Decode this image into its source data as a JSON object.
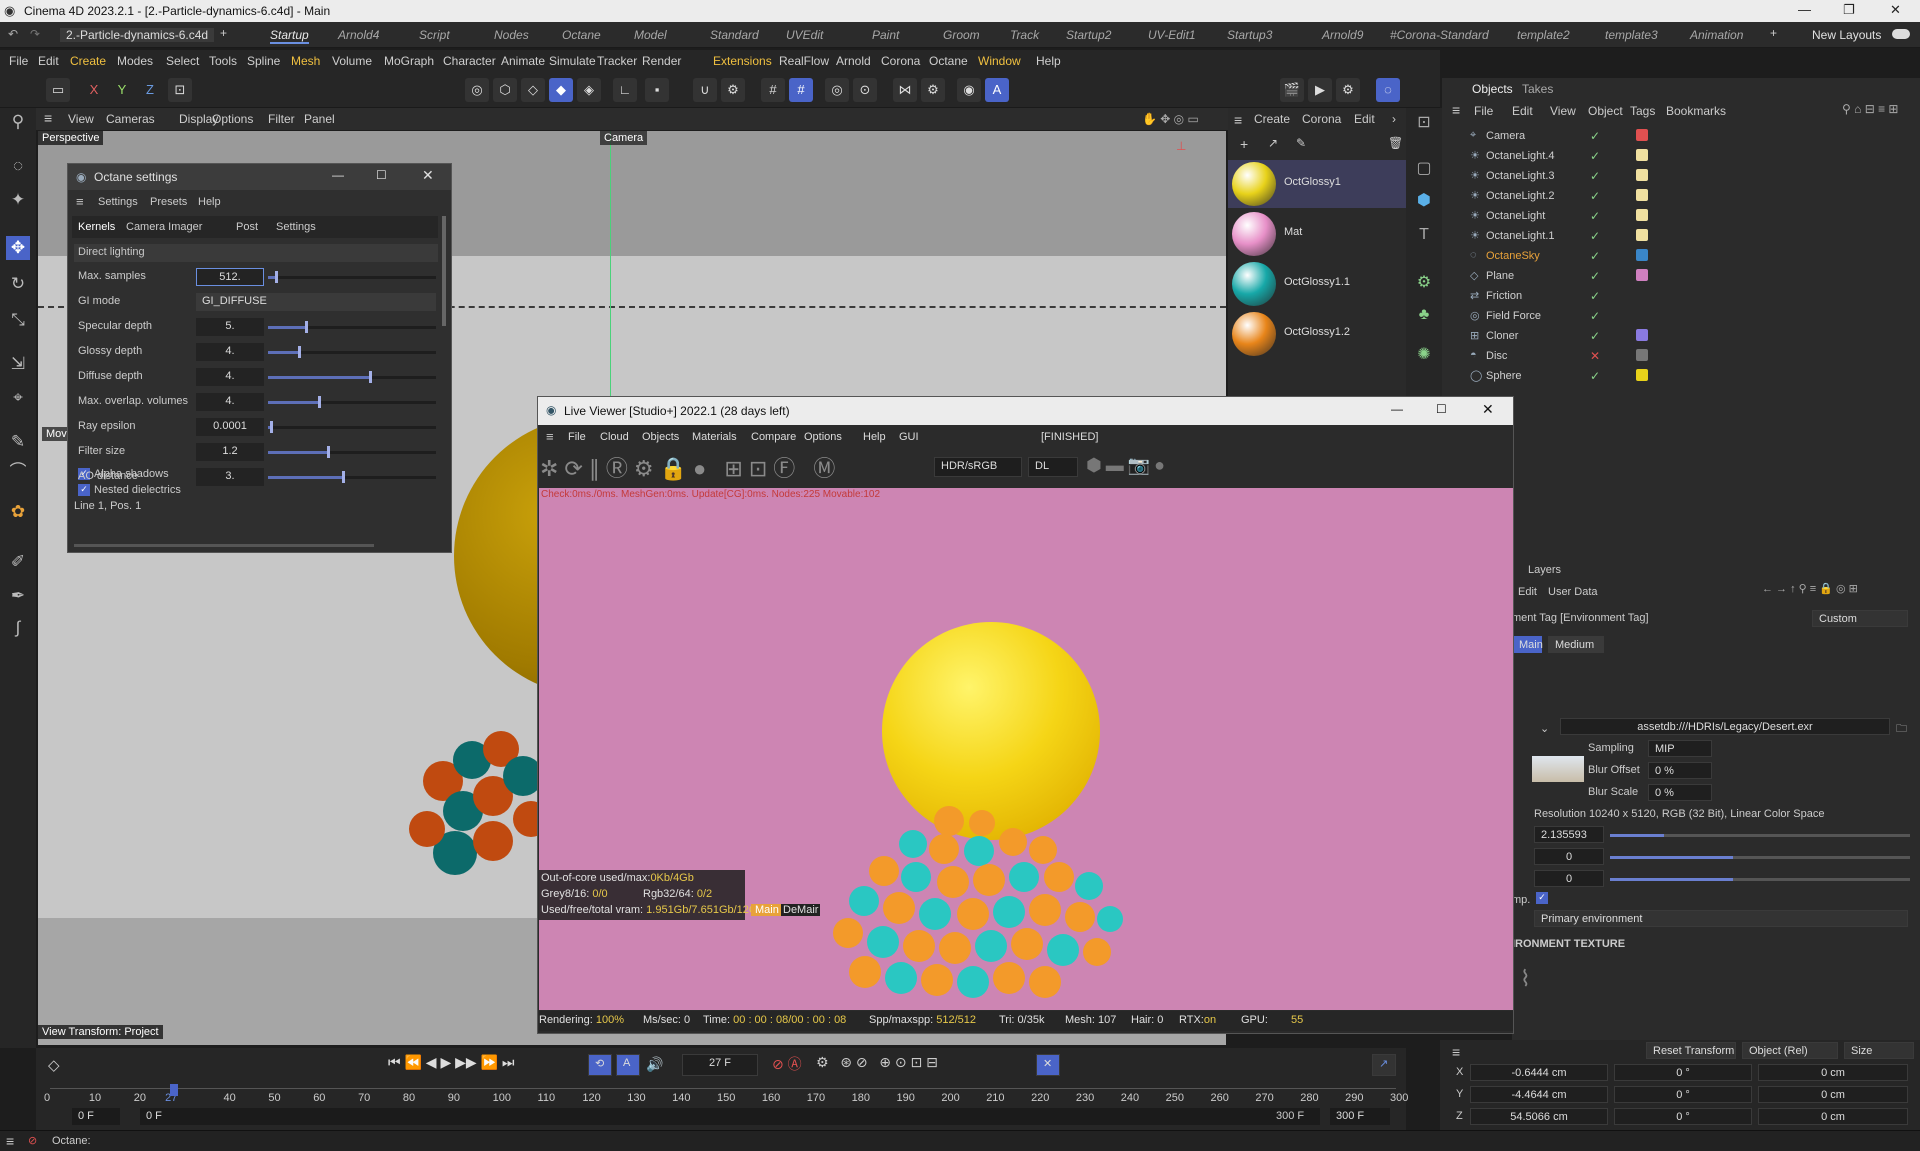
{
  "window": {
    "title": "Cinema 4D 2023.2.1 - [2.-Particle-dynamics-6.c4d] - Main"
  },
  "doc_tab": "2.-Particle-dynamics-6.c4d",
  "layout_tabs": [
    "Startup",
    "Arnold4",
    "Script",
    "Nodes",
    "Octane",
    "Model",
    "Standard",
    "UVEdit",
    "Paint",
    "Groom",
    "Track",
    "Startup2",
    "UV-Edit1",
    "Startup3",
    "Arnold9",
    "#Corona-Standard",
    "template2",
    "template3",
    "Animation"
  ],
  "active_layout": "Startup",
  "new_layouts": "New Layouts",
  "menu": [
    "File",
    "Edit",
    "Create",
    "Modes",
    "Select",
    "Tools",
    "Spline",
    "Mesh",
    "Volume",
    "MoGraph",
    "Character",
    "Animate",
    "Simulate",
    "Tracker",
    "Render",
    "Extensions",
    "RealFlow",
    "Arnold",
    "Corona",
    "Octane",
    "Window",
    "Help"
  ],
  "viewport": {
    "menu": [
      "View",
      "Cameras",
      "Display",
      "Options",
      "Filter",
      "Panel"
    ],
    "label": "Perspective",
    "camera_label": "Camera",
    "move_label": "Mov",
    "transform_label": "View Transform: Project"
  },
  "materials": {
    "menu": [
      "Create",
      "Corona",
      "Edit"
    ],
    "items": [
      {
        "name": "OctGlossy1",
        "color": "#e8d21a"
      },
      {
        "name": "Mat",
        "color": "#e790c8"
      },
      {
        "name": "OctGlossy1.1",
        "color": "#17a8a8"
      },
      {
        "name": "OctGlossy1.2",
        "color": "#e8851a"
      }
    ]
  },
  "objects_panel": {
    "tabs": [
      "Objects",
      "Takes"
    ],
    "menu": [
      "File",
      "Edit",
      "View",
      "Object",
      "Tags",
      "Bookmarks"
    ],
    "items": [
      {
        "name": "Camera",
        "color": "#d0d0d0"
      },
      {
        "name": "OctaneLight.4",
        "color": "#d0d0d0"
      },
      {
        "name": "OctaneLight.3",
        "color": "#d0d0d0"
      },
      {
        "name": "OctaneLight.2",
        "color": "#d0d0d0"
      },
      {
        "name": "OctaneLight",
        "color": "#d0d0d0"
      },
      {
        "name": "OctaneLight.1",
        "color": "#d0d0d0"
      },
      {
        "name": "OctaneSky",
        "color": "#e8a23a"
      },
      {
        "name": "Plane",
        "color": "#d0d0d0"
      },
      {
        "name": "Friction",
        "color": "#d0d0d0"
      },
      {
        "name": "Field Force",
        "color": "#d0d0d0"
      },
      {
        "name": "Cloner",
        "color": "#d0d0d0"
      },
      {
        "name": "Disc",
        "color": "#d0d0d0"
      },
      {
        "name": "Sphere",
        "color": "#d0d0d0"
      }
    ]
  },
  "attributes": {
    "layers_tab": "Layers",
    "menu": [
      "Edit",
      "User Data"
    ],
    "tag_title": "ment Tag [Environment Tag]",
    "mode": "Custom",
    "tabs": [
      "Main",
      "Medium"
    ],
    "texture_path": "assetdb:///HDRIs/Legacy/Desert.exr",
    "sampling_label": "Sampling",
    "sampling_value": "MIP",
    "blur_offset_label": "Blur Offset",
    "blur_offset_value": "0 %",
    "blur_scale_label": "Blur Scale",
    "blur_scale_value": "0 %",
    "resolution": "Resolution 10240 x 5120, RGB (32 Bit), Linear Color Space",
    "power": "2.135593",
    "rot_x": "0",
    "rot_y": "0",
    "imp_label": "mp.",
    "env_type": "Primary environment",
    "section": "IRONMENT TEXTURE"
  },
  "coords": {
    "reset": "Reset Transform",
    "mode": "Object (Rel)",
    "size": "Size",
    "rows": [
      {
        "axis": "X",
        "pos": "-0.6444 cm",
        "rot": "0 °",
        "size": "0 cm"
      },
      {
        "axis": "Y",
        "pos": "-4.4644 cm",
        "rot": "0 °",
        "size": "0 cm"
      },
      {
        "axis": "Z",
        "pos": "54.5066 cm",
        "rot": "0 °",
        "size": "0 cm"
      }
    ]
  },
  "timeline": {
    "frame": "27 F",
    "ticks": [
      "0",
      "10",
      "20",
      "27",
      "40",
      "50",
      "60",
      "70",
      "80",
      "90",
      "100",
      "110",
      "120",
      "130",
      "140",
      "150",
      "160",
      "170",
      "180",
      "190",
      "200",
      "210",
      "220",
      "230",
      "240",
      "250",
      "260",
      "270",
      "280",
      "290",
      "300"
    ],
    "start": "0 F",
    "start2": "0 F",
    "end": "300 F",
    "end2": "300 F"
  },
  "status": {
    "text": "Octane:"
  },
  "octane_settings": {
    "title": "Octane settings",
    "menu": [
      "Settings",
      "Presets",
      "Help"
    ],
    "tabs": [
      "Kernels",
      "Camera Imager",
      "Post",
      "Settings"
    ],
    "section": "Direct lighting",
    "rows": [
      {
        "label": "Max. samples",
        "value": "512.",
        "fill": 0.04
      },
      {
        "label": "GI mode",
        "value": "GI_DIFFUSE"
      },
      {
        "label": "Specular depth",
        "value": "5.",
        "fill": 0.22
      },
      {
        "label": "Glossy depth",
        "value": "4.",
        "fill": 0.18
      },
      {
        "label": "Diffuse depth",
        "value": "4.",
        "fill": 0.6
      },
      {
        "label": "Max. overlap. volumes",
        "value": "4.",
        "fill": 0.3
      },
      {
        "label": "Ray epsilon",
        "value": "0.0001",
        "fill": 0.01
      },
      {
        "label": "Filter size",
        "value": "1.2",
        "fill": 0.35
      },
      {
        "label": "AO distance",
        "value": "3.",
        "fill": 0.44
      }
    ],
    "check1": "Alpha shadows",
    "check2": "Nested dielectrics",
    "status": "Line 1, Pos. 1"
  },
  "live_viewer": {
    "title": "Live Viewer [Studio+] 2022.1 (28 days left)",
    "menu": [
      "File",
      "Cloud",
      "Objects",
      "Materials",
      "Compare",
      "Options",
      "Help",
      "GUI"
    ],
    "state": "[FINISHED]",
    "colorspace": "HDR/sRGB",
    "kernel": "DL",
    "check_line": "Check:0ms./0ms. MeshGen:0ms. Update[CG]:0ms. Nodes:225 Movable:102",
    "ooc": "Out-of-core used/max:",
    "ooc_val": "0Kb/4Gb",
    "grey": "Grey8/16: ",
    "grey_val": "0/0",
    "rgb": "Rgb32/64: ",
    "rgb_val": "0/2",
    "vram": "Used/free/total vram: ",
    "vram_val": "1.951Gb/7.651Gb/12Gb",
    "tag_main": "Main",
    "tag_demain": "DeMair",
    "rendering": "Rendering: ",
    "rendering_val": "100%",
    "mssec": "Ms/sec: 0",
    "time": "Time: ",
    "time_val": "00 : 00 : 08/00 : 00 : 08",
    "spp": "Spp/maxspp: ",
    "spp_val": "512/512",
    "tri": "Tri: 0/35k",
    "mesh": "Mesh: 107",
    "hair": "Hair: 0",
    "rtx": "RTX:",
    "rtx_val": "on",
    "gpu": "GPU:",
    "gpu_val": "55"
  },
  "colors": {
    "accent": "#4a64c8",
    "highlight": "#e8a23a",
    "render_bg": "#cd85b3"
  }
}
